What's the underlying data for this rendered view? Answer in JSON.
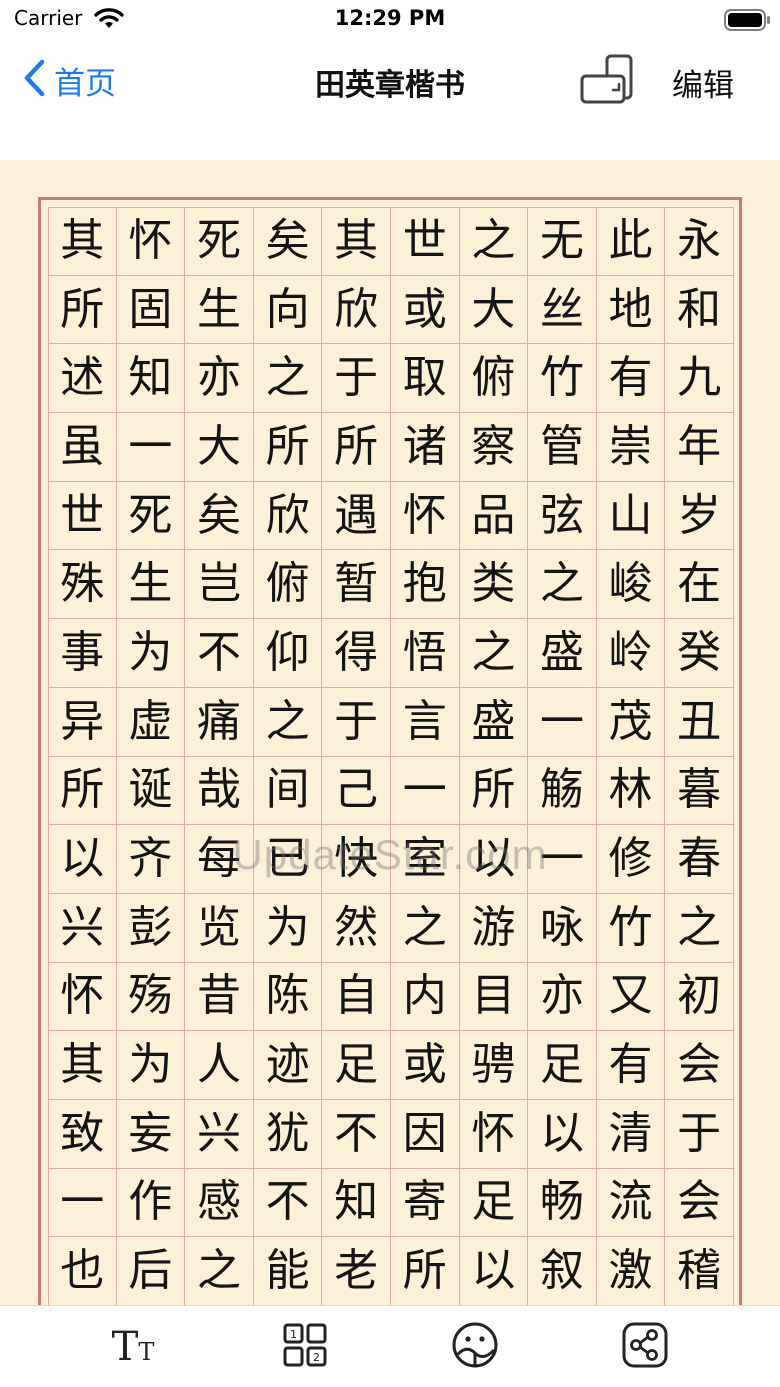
{
  "status_bar": {
    "carrier": "Carrier",
    "time": "12:29 PM"
  },
  "nav": {
    "back_label": "首页",
    "title": "田英章楷书",
    "edit_label": "编辑"
  },
  "calligraphy": {
    "columns": [
      "永和九年岁在癸丑暮春之初会于会稽",
      "此地有崇山峻岭茂林修竹又有清流激",
      "无丝竹管弦之盛一觞一咏亦足以畅叙",
      "之大俯察品类之盛所以游目骋怀足以",
      "世或取诸怀抱悟言一室之内或因寄所",
      "其欣于所遇暂得于己快然自足不知老",
      "矣向之所欣俯仰之间已为陈迹犹不能",
      "死生亦大矣岂不痛哉每览昔人兴感之",
      "怀固知一死生为虚诞齐彭殇为妄作后",
      "其所述虽世殊事异所以兴怀其致一也"
    ]
  },
  "watermark": "UpdateStar.com",
  "tab_bar": {
    "font_size_big": "T",
    "font_size_small": "T",
    "icons": [
      "text-size-icon",
      "grid-layout-icon",
      "style-icon",
      "share-icon"
    ]
  }
}
